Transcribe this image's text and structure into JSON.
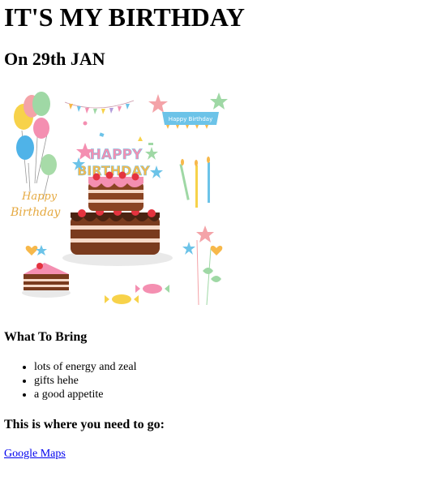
{
  "header": {
    "title": "IT'S MY BIRTHDAY",
    "date_line": "On 29th JAN"
  },
  "image": {
    "banner_text": "HAPPY BIRTHDAY",
    "script_text_top": "Happy",
    "script_text_bottom": "Birthday",
    "flag_text": "Happy Birthday"
  },
  "bring": {
    "heading": "What To Bring",
    "items": [
      "lots of energy and zeal",
      "gifts hehe",
      "a good appetite"
    ]
  },
  "directions": {
    "heading": "This is where you need to go:",
    "link_label": "Google Maps"
  },
  "colors": {
    "link": "#0000ee",
    "text": "#000000",
    "background": "#ffffff"
  }
}
